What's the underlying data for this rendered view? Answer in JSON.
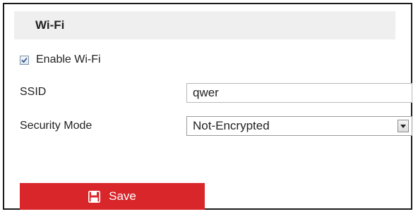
{
  "header": {
    "title": "Wi-Fi"
  },
  "enable_wifi": {
    "label": "Enable Wi-Fi",
    "checked": true
  },
  "ssid": {
    "label": "SSID",
    "value": "qwer"
  },
  "security_mode": {
    "label": "Security Mode",
    "selected": "Not-Encrypted"
  },
  "save": {
    "label": "Save",
    "icon": "floppy-disk-icon",
    "color": "#d8262b"
  }
}
